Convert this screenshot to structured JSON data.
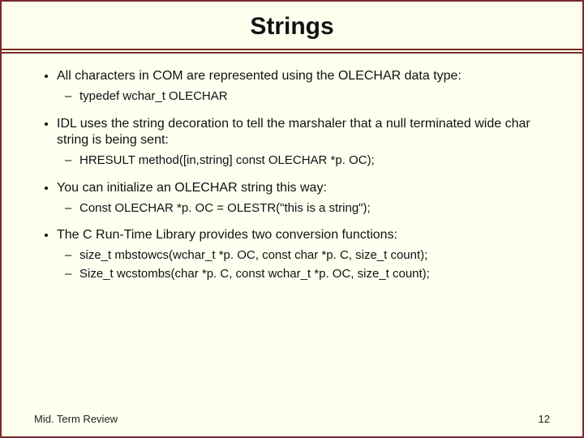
{
  "title": "Strings",
  "bullets": [
    {
      "text": "All characters in COM are represented using the OLECHAR data type:",
      "subs": [
        "typedef wchar_t OLECHAR"
      ]
    },
    {
      "text": "IDL uses the string decoration to tell the marshaler that a null terminated wide char string is being sent:",
      "subs": [
        "HRESULT method([in,string] const OLECHAR *p. OC);"
      ]
    },
    {
      "text": "You can initialize an OLECHAR string this way:",
      "subs": [
        "Const OLECHAR *p. OC = OLESTR(\"this is a string\");"
      ]
    },
    {
      "text": "The C Run-Time Library provides two conversion functions:",
      "subs": [
        "size_t mbstowcs(wchar_t *p. OC, const char *p. C, size_t count);",
        "Size_t wcstombs(char *p. C, const wchar_t *p. OC, size_t count);"
      ]
    }
  ],
  "footer_left": "Mid. Term Review",
  "footer_right": "12"
}
